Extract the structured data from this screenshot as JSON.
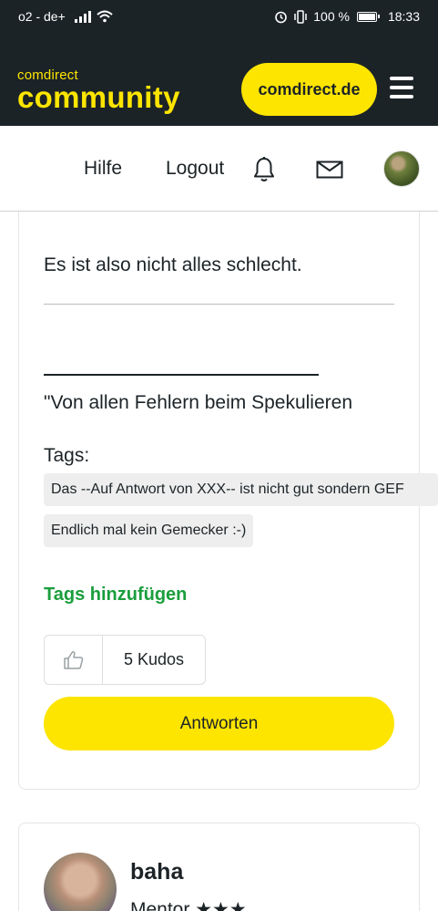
{
  "status_bar": {
    "carrier": "o2 - de+",
    "battery": "100 %",
    "time": "18:33"
  },
  "header": {
    "logo_small": "comdirect",
    "logo_big": "community",
    "site_button": "comdirect.de"
  },
  "nav": {
    "help": "Hilfe",
    "logout": "Logout"
  },
  "post": {
    "line1": "Es ist also nicht alles schlecht.",
    "quote": "\"Von allen Fehlern beim Spekulieren",
    "tags_label": "Tags:",
    "tags": [
      "Das --Auf Antwort von XXX-- ist nicht gut sondern GEF",
      "Endlich mal kein Gemecker :-)"
    ],
    "add_tags": "Tags hinzufügen",
    "kudos": "5 Kudos",
    "reply": "Antworten"
  },
  "next_post": {
    "username": "baha",
    "rank": "Mentor ★★★"
  },
  "colors": {
    "brand_yellow": "#fde500",
    "header_dark": "#1c2327",
    "tag_green": "#1a9e3c"
  }
}
